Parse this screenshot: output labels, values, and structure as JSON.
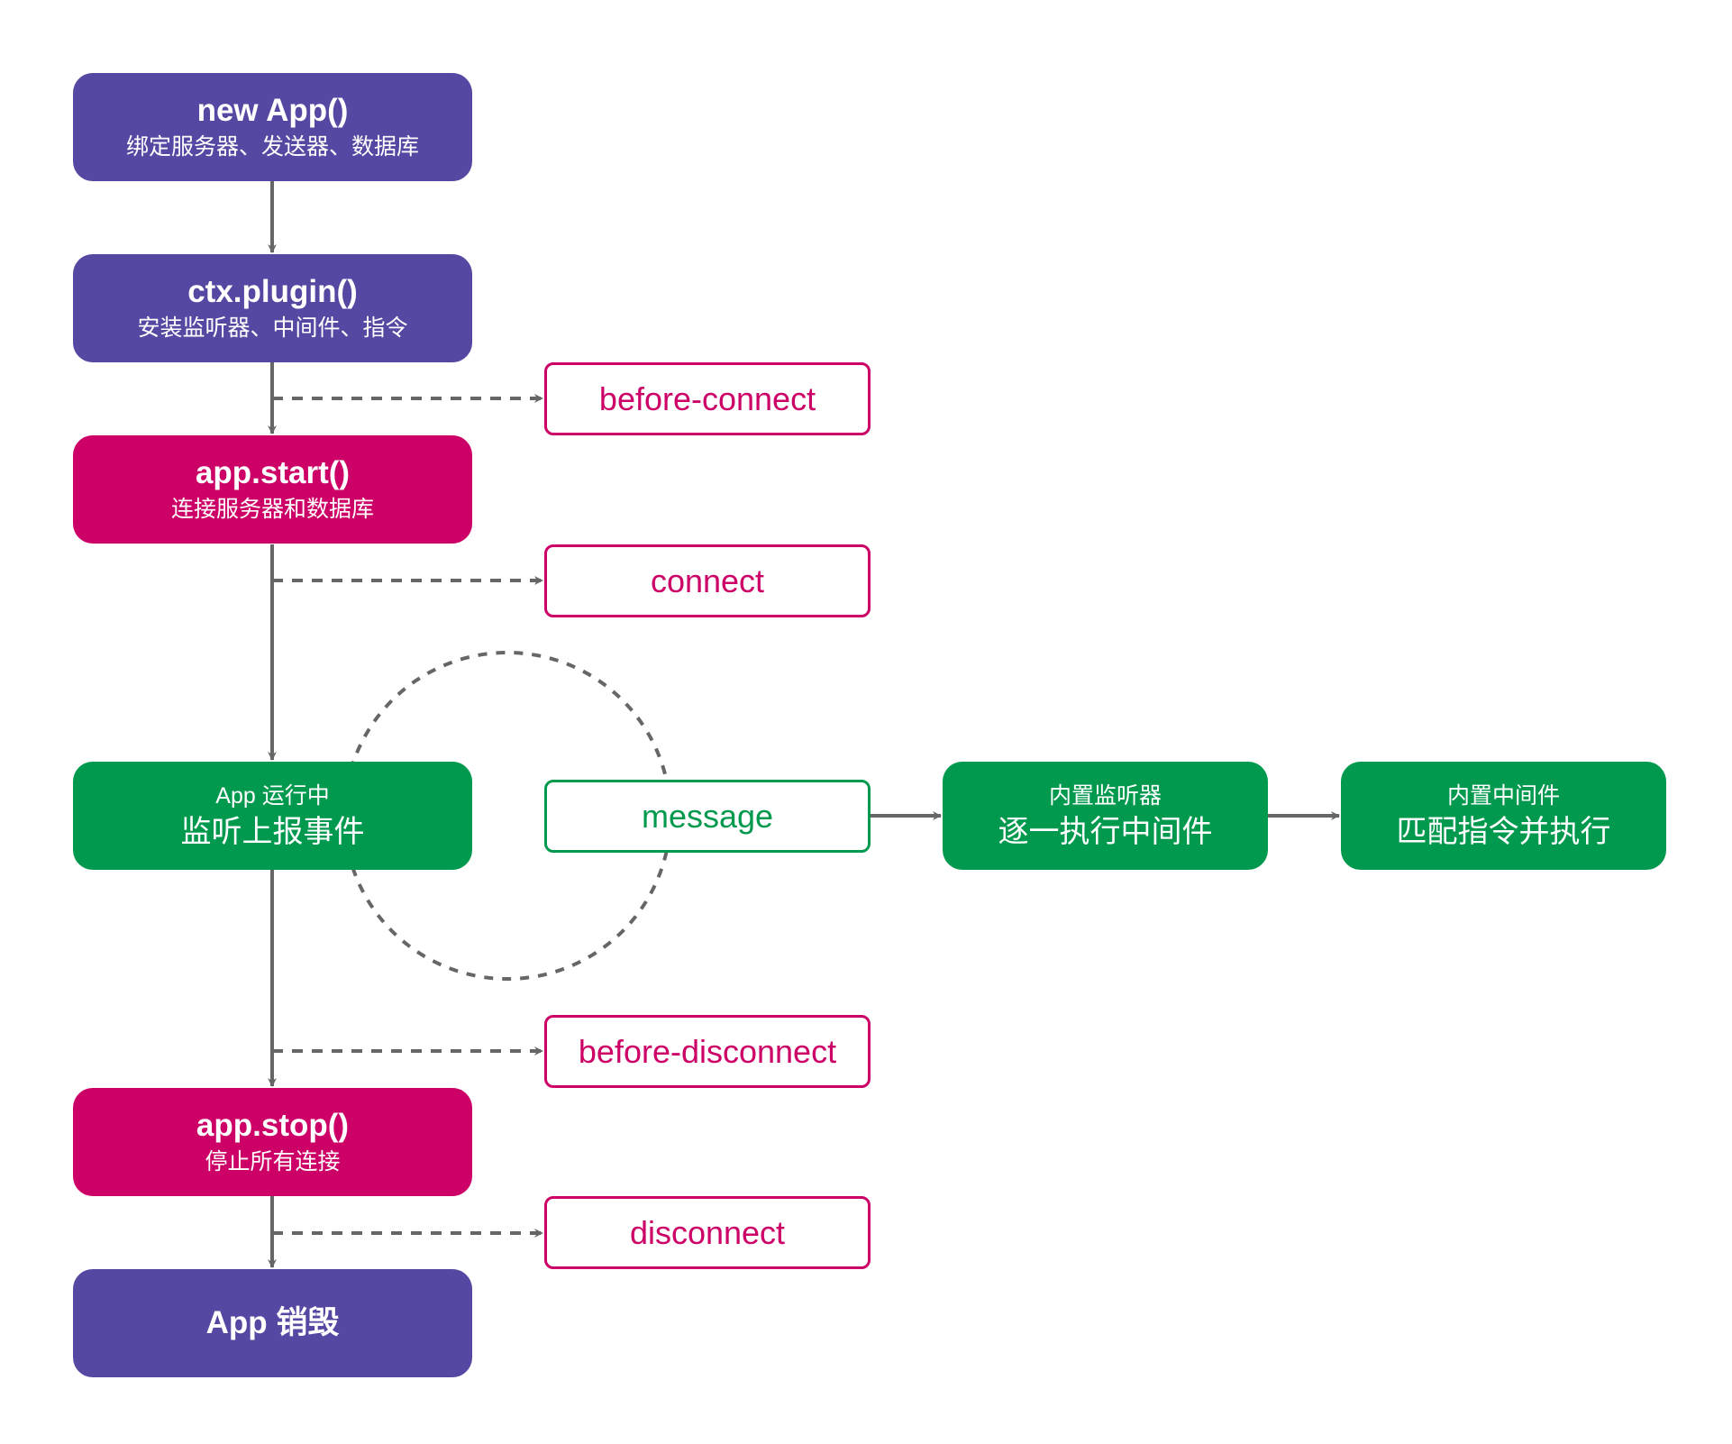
{
  "colors": {
    "lifecycle": "#5548a3",
    "action": "#cc0066",
    "running": "#00994d",
    "connector": "#666666"
  },
  "main_flow": [
    {
      "title": "new App()",
      "subtitle": "绑定服务器、发送器、数据库"
    },
    {
      "title": "ctx.plugin()",
      "subtitle": "安装监听器、中间件、指令"
    },
    {
      "title": "app.start()",
      "subtitle": "连接服务器和数据库"
    },
    {
      "title": "App 运行中",
      "subtitle": "监听上报事件"
    },
    {
      "title": "app.stop()",
      "subtitle": "停止所有连接"
    },
    {
      "title": "App 销毁"
    }
  ],
  "events": {
    "before_connect": "before-connect",
    "connect": "connect",
    "message": "message",
    "before_disconnect": "before-disconnect",
    "disconnect": "disconnect"
  },
  "message_flow": [
    {
      "title": "内置监听器",
      "subtitle": "逐一执行中间件"
    },
    {
      "title": "内置中间件",
      "subtitle": "匹配指令并执行"
    }
  ]
}
